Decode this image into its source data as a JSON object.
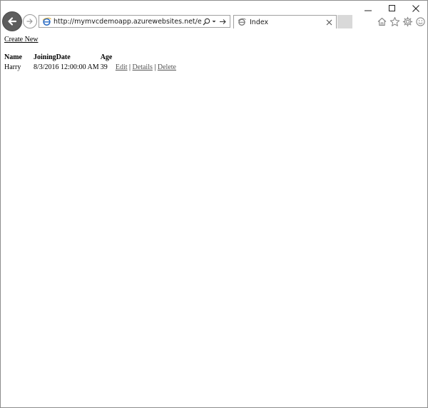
{
  "browser": {
    "address_url": "http://mymvcdemoapp.azurewebsites.net/employees",
    "tab_title": "Index"
  },
  "page": {
    "create_new_label": "Create New",
    "table": {
      "headers": {
        "name": "Name",
        "joining_date": "JoiningDate",
        "age": "Age"
      },
      "rows": [
        {
          "name": "Harry",
          "joining_date": "8/3/2016 12:00:00 AM",
          "age": "39",
          "edit": "Edit",
          "details": "Details",
          "delete": "Delete",
          "separator": "|"
        }
      ]
    }
  },
  "colors": {
    "back_button": "#5d5d5d",
    "border": "#a0a0a0",
    "new_tab": "#d9d9d9",
    "link_muted": "#555555"
  }
}
